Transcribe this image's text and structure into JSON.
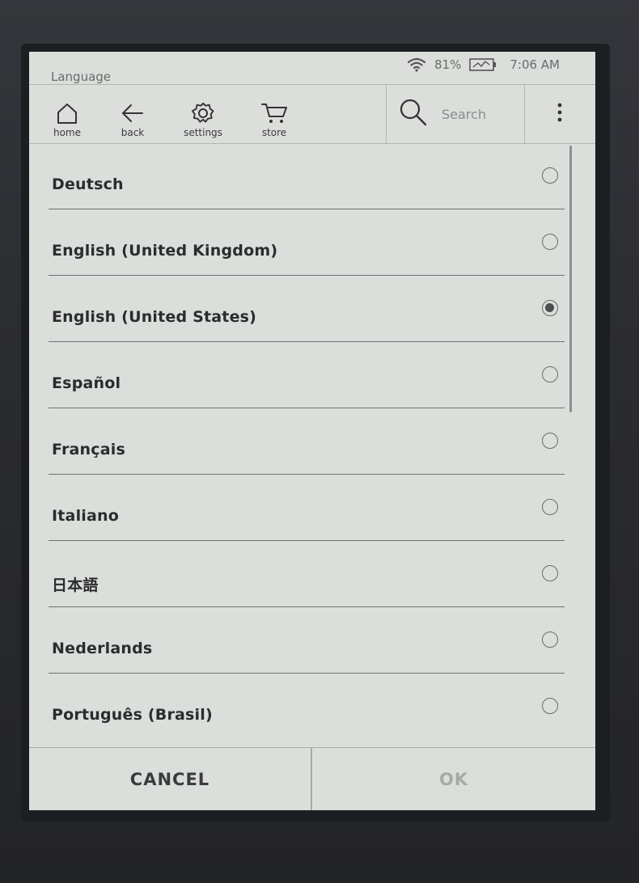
{
  "status_bar": {
    "title": "Language",
    "battery": "81%",
    "time": "7:06 AM"
  },
  "toolbar": {
    "home_label": "home",
    "back_label": "back",
    "settings_label": "settings",
    "store_label": "store",
    "search_placeholder": "Search"
  },
  "languages": [
    {
      "label": "Deutsch",
      "selected": false
    },
    {
      "label": "English (United Kingdom)",
      "selected": false
    },
    {
      "label": "English (United States)",
      "selected": true
    },
    {
      "label": "Español",
      "selected": false
    },
    {
      "label": "Français",
      "selected": false
    },
    {
      "label": "Italiano",
      "selected": false
    },
    {
      "label": "日本語",
      "selected": false
    },
    {
      "label": "Nederlands",
      "selected": false
    },
    {
      "label": "Português (Brasil)",
      "selected": false
    }
  ],
  "footer": {
    "cancel_label": "CANCEL",
    "ok_label": "OK"
  },
  "icons": {
    "status": [
      "wifi-icon",
      "battery-icon"
    ],
    "toolbar": [
      "home-icon",
      "back-arrow-icon",
      "settings-gear-icon",
      "cart-icon",
      "search-icon",
      "more-vertical-icon"
    ]
  }
}
